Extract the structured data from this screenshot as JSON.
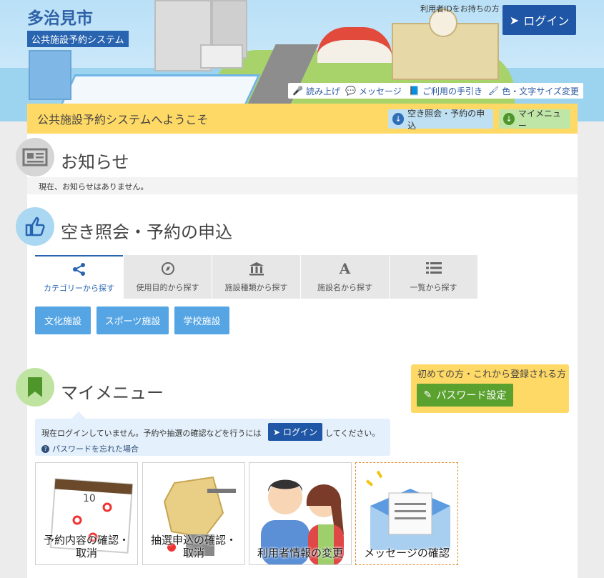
{
  "header": {
    "city_name": "多治見市",
    "system_name": "公共施設予約システム",
    "login_hint": "利用者IDをお持ちの方",
    "login_label": "ログイン",
    "utilities": [
      "読み上げ",
      "メッセージ",
      "ご利用の手引き",
      "色・文字サイズ変更"
    ]
  },
  "welcome": {
    "text": "公共施設予約システムへようこそ",
    "jump_reserve": "空き照会・予約の申込",
    "jump_mymenu": "マイメニュー"
  },
  "news": {
    "title": "お知らせ",
    "message": "現在、お知らせはありません。"
  },
  "reserve": {
    "title": "空き照会・予約の申込",
    "tabs": [
      {
        "label": "カテゴリーから探す",
        "icon": "share-icon"
      },
      {
        "label": "使用目的から探す",
        "icon": "compass-icon"
      },
      {
        "label": "施設種類から探す",
        "icon": "institution-icon"
      },
      {
        "label": "施設名から探す",
        "icon": "font-a-icon"
      },
      {
        "label": "一覧から探す",
        "icon": "list-icon"
      }
    ],
    "categories": [
      "文化施設",
      "スポーツ施設",
      "学校施設"
    ]
  },
  "mymenu": {
    "title": "マイメニュー",
    "first_time_label": "初めての方・これから登録される方",
    "password_button": "パスワード設定",
    "not_logged_text": "現在ログインしていません。予約や抽選の確認などを行うには",
    "login_button": "ログイン",
    "not_logged_suffix": "してください。",
    "forgot_password": "パスワードを忘れた場合",
    "cards": [
      {
        "line1": "予約内容の確認・",
        "line2": "取消"
      },
      {
        "line1": "抽選申込の確認・",
        "line2": "取消"
      },
      {
        "line1": "利用者情報の変更",
        "line2": ""
      },
      {
        "line1": "メッセージの確認",
        "line2": ""
      }
    ]
  },
  "colors": {
    "brand_blue": "#2864b0",
    "welcome_yellow": "#ffd966",
    "button_blue": "#55a5e4",
    "button_green": "#5aa12f"
  }
}
